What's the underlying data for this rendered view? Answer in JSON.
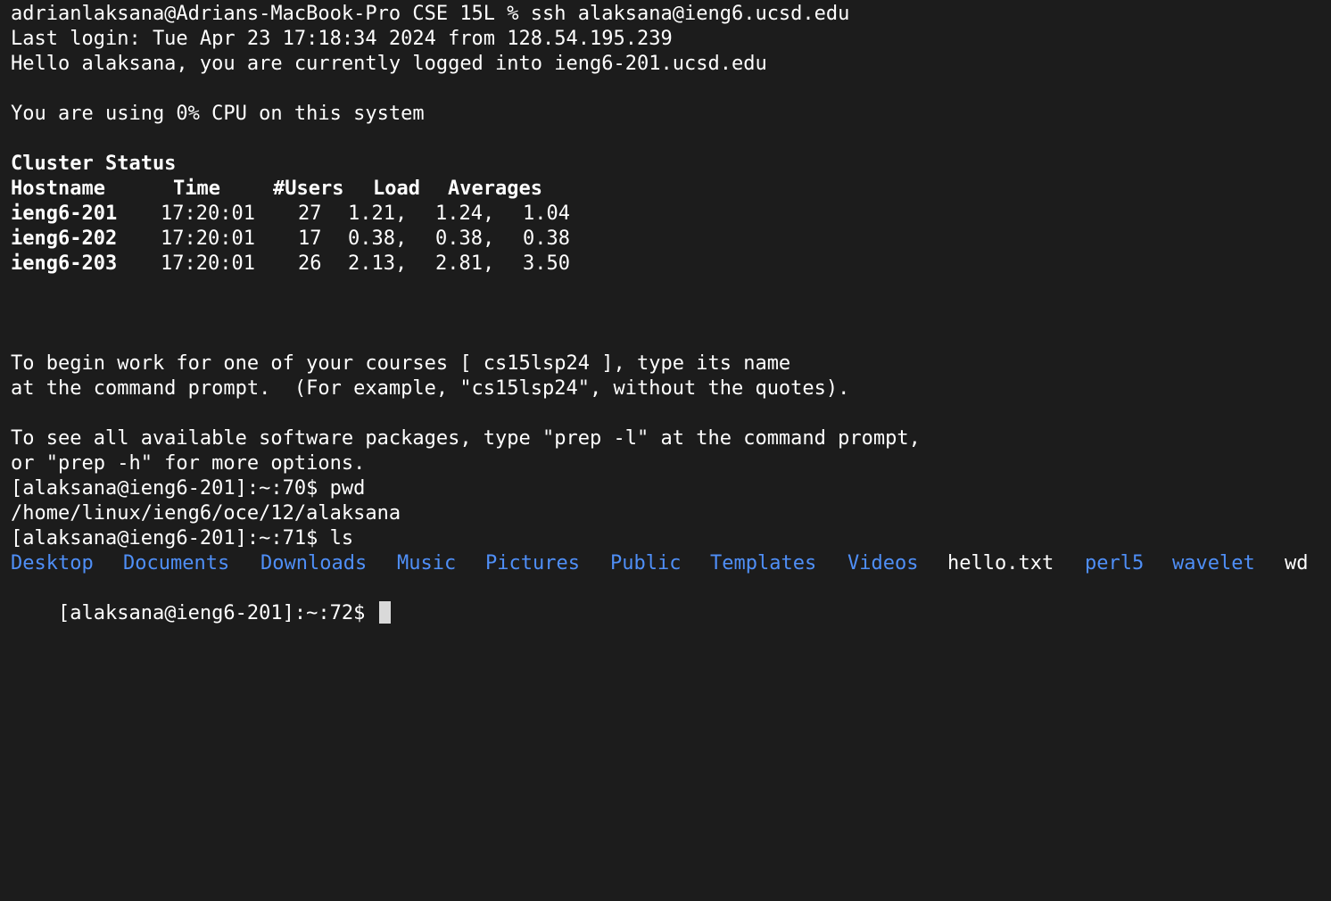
{
  "terminal": {
    "ssh_command": "adrianlaksana@Adrians-MacBook-Pro CSE 15L % ssh alaksana@ieng6.ucsd.edu",
    "last_login": "Last login: Tue Apr 23 17:18:34 2024 from 128.54.195.239",
    "hello": "Hello alaksana, you are currently logged into ieng6-201.ucsd.edu",
    "cpu": "You are using 0% CPU on this system",
    "cluster_status": {
      "title": "Cluster Status",
      "headers": [
        "Hostname",
        "Time",
        "#Users",
        "Load",
        "Averages"
      ],
      "rows": [
        {
          "hostname": "ieng6-201",
          "time": "17:20:01",
          "users": "27",
          "load": "1.21,",
          "avg2": "1.24,",
          "avg3": "1.04"
        },
        {
          "hostname": "ieng6-202",
          "time": "17:20:01",
          "users": "17",
          "load": "0.38,",
          "avg2": "0.38,",
          "avg3": "0.38"
        },
        {
          "hostname": "ieng6-203",
          "time": "17:20:01",
          "users": "26",
          "load": "2.13,",
          "avg2": "2.81,",
          "avg3": "3.50"
        }
      ]
    },
    "course_info_1": "To begin work for one of your courses [ cs15lsp24 ], type its name",
    "course_info_2": "at the command prompt.  (For example, \"cs15lsp24\", without the quotes).",
    "prep_info_1": "To see all available software packages, type \"prep -l\" at the command prompt,",
    "prep_info_2": "or \"prep -h\" for more options.",
    "prompt_pwd": "[alaksana@ieng6-201]:~:70$ pwd",
    "pwd_output": "/home/linux/ieng6/oce/12/alaksana",
    "prompt_ls": "[alaksana@ieng6-201]:~:71$ ls",
    "ls_output": [
      {
        "name": "Desktop",
        "kind": "dir"
      },
      {
        "name": "Documents",
        "kind": "dir"
      },
      {
        "name": "Downloads",
        "kind": "dir"
      },
      {
        "name": "Music",
        "kind": "dir"
      },
      {
        "name": "Pictures",
        "kind": "dir"
      },
      {
        "name": "Public",
        "kind": "dir"
      },
      {
        "name": "Templates",
        "kind": "dir"
      },
      {
        "name": "Videos",
        "kind": "dir"
      },
      {
        "name": "hello.txt",
        "kind": "file"
      },
      {
        "name": "perl5",
        "kind": "dir"
      },
      {
        "name": "wavelet",
        "kind": "dir"
      },
      {
        "name": "wd",
        "kind": "file"
      }
    ],
    "current_prompt": "[alaksana@ieng6-201]:~:72$ ",
    "colors": {
      "background": "#1c1c1c",
      "text": "#ffffff",
      "directory": "#4f8ff7",
      "cursor": "#d9d9d9"
    }
  }
}
